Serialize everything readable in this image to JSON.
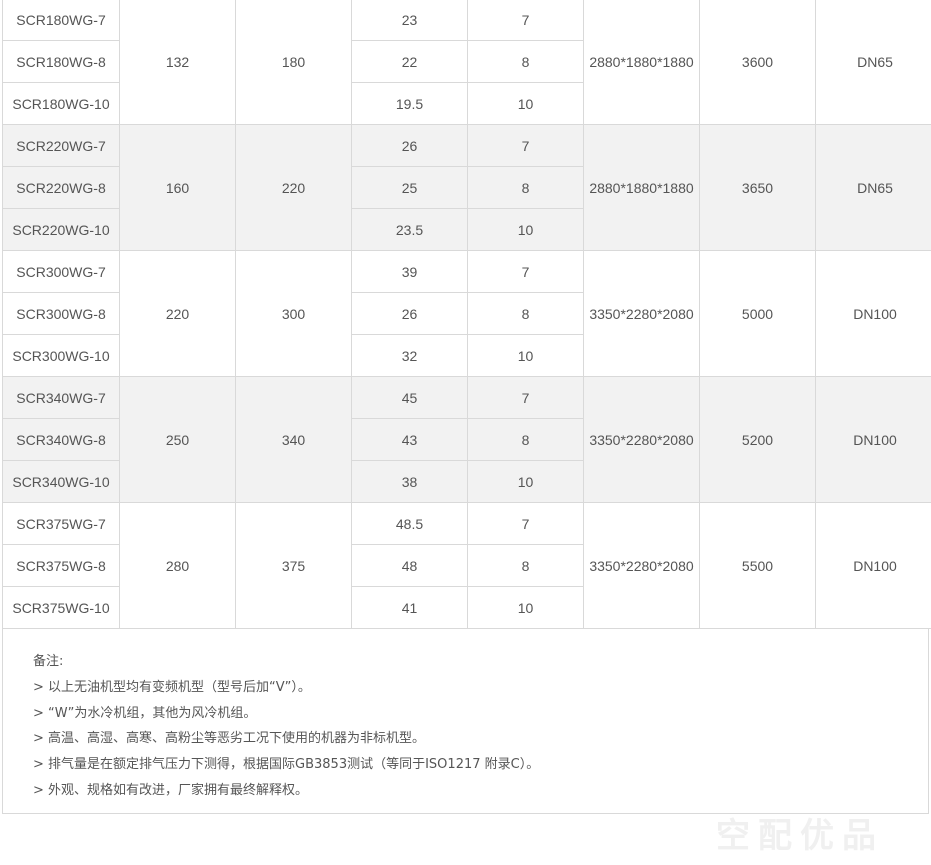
{
  "table": {
    "groups": [
      {
        "shaded": false,
        "col2": "132",
        "col3": "180",
        "dimensions": "2880*1880*1880",
        "weight": "3600",
        "outlet": "DN65",
        "rows": [
          {
            "model": "SCR180WG-7",
            "flow": "23",
            "pressure": "7"
          },
          {
            "model": "SCR180WG-8",
            "flow": "22",
            "pressure": "8"
          },
          {
            "model": "SCR180WG-10",
            "flow": "19.5",
            "pressure": "10"
          }
        ]
      },
      {
        "shaded": true,
        "col2": "160",
        "col3": "220",
        "dimensions": "2880*1880*1880",
        "weight": "3650",
        "outlet": "DN65",
        "rows": [
          {
            "model": "SCR220WG-7",
            "flow": "26",
            "pressure": "7"
          },
          {
            "model": "SCR220WG-8",
            "flow": "25",
            "pressure": "8"
          },
          {
            "model": "SCR220WG-10",
            "flow": "23.5",
            "pressure": "10"
          }
        ]
      },
      {
        "shaded": false,
        "col2": "220",
        "col3": "300",
        "dimensions": "3350*2280*2080",
        "weight": "5000",
        "outlet": "DN100",
        "rows": [
          {
            "model": "SCR300WG-7",
            "flow": "39",
            "pressure": "7"
          },
          {
            "model": "SCR300WG-8",
            "flow": "26",
            "pressure": "8"
          },
          {
            "model": "SCR300WG-10",
            "flow": "32",
            "pressure": "10"
          }
        ]
      },
      {
        "shaded": true,
        "col2": "250",
        "col3": "340",
        "dimensions": "3350*2280*2080",
        "weight": "5200",
        "outlet": "DN100",
        "rows": [
          {
            "model": "SCR340WG-7",
            "flow": "45",
            "pressure": "7"
          },
          {
            "model": "SCR340WG-8",
            "flow": "43",
            "pressure": "8"
          },
          {
            "model": "SCR340WG-10",
            "flow": "38",
            "pressure": "10"
          }
        ]
      },
      {
        "shaded": false,
        "col2": "280",
        "col3": "375",
        "dimensions": "3350*2280*2080",
        "weight": "5500",
        "outlet": "DN100",
        "rows": [
          {
            "model": "SCR375WG-7",
            "flow": "48.5",
            "pressure": "7"
          },
          {
            "model": "SCR375WG-8",
            "flow": "48",
            "pressure": "8"
          },
          {
            "model": "SCR375WG-10",
            "flow": "41",
            "pressure": "10"
          }
        ]
      }
    ]
  },
  "notes": {
    "title": "备注:",
    "lines": [
      "> 以上无油机型均有变频机型（型号后加“V”）。",
      " > “W”为水冷机组，其他为风冷机组。",
      "> 高温、高湿、高寒、高粉尘等恶劣工况下使用的机器为非标机型。",
      "> 排气量是在额定排气压力下测得，根据国际GB3853测试（等同于ISO1217 附录C）。",
      " > 外观、规格如有改进，厂家拥有最终解释权。"
    ]
  },
  "watermark": "空配优品"
}
